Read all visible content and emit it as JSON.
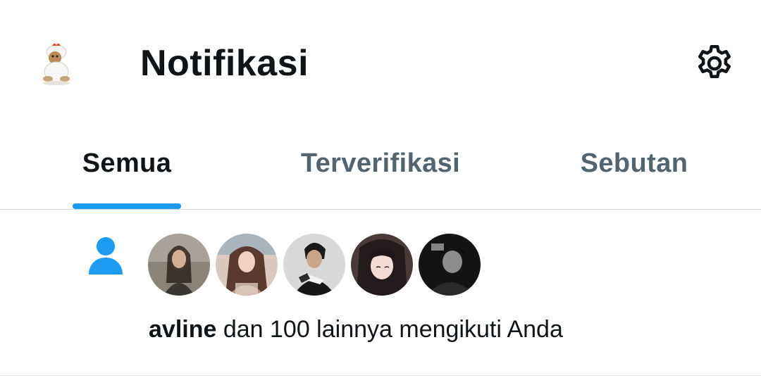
{
  "header": {
    "title": "Notifikasi",
    "avatar_icon": "profile-avatar",
    "settings_icon": "gear-icon"
  },
  "tabs": [
    {
      "label": "Semua",
      "active": true
    },
    {
      "label": "Terverifikasi",
      "active": false
    },
    {
      "label": "Sebutan",
      "active": false
    }
  ],
  "notification": {
    "type_icon": "person-icon",
    "user": "avline",
    "text": " dan 100 lainnya mengikuti Anda",
    "follower_count_shown": 5
  },
  "colors": {
    "accent": "#1d9bf0",
    "text_primary": "#0f1419",
    "text_secondary": "#536471",
    "divider": "#d8e0e4"
  }
}
